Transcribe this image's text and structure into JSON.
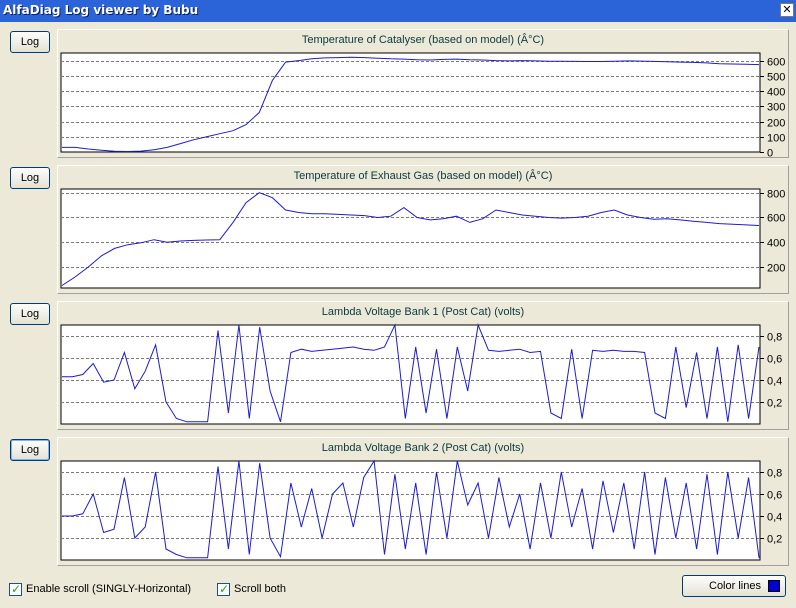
{
  "window": {
    "title": "AlfaDiag Log viewer by Bubu",
    "close_glyph": "✕"
  },
  "colors": {
    "line": "#1c1ccf",
    "title_bar": "#2a64d8",
    "swatch": "#0000d8"
  },
  "log_button_label": "Log",
  "charts": [
    {
      "title": "Temperature of Catalyser (based on model) (Â°C)",
      "y_ticks": [
        "600",
        "500",
        "400",
        "300",
        "200",
        "100",
        "0"
      ],
      "ylim": [
        0,
        650
      ]
    },
    {
      "title": "Temperature of Exhaust Gas (based on model) (Â°C)",
      "y_ticks": [
        "800",
        "600",
        "400",
        "200"
      ],
      "ylim": [
        30,
        830
      ]
    },
    {
      "title": "Lambda Voltage Bank 1 (Post Cat) (volts)",
      "y_ticks": [
        "0,8",
        "0,6",
        "0,4",
        "0,2"
      ],
      "ylim": [
        0,
        0.9
      ]
    },
    {
      "title": "Lambda Voltage Bank 2 (Post Cat) (volts)",
      "y_ticks": [
        "0,8",
        "0,6",
        "0,4",
        "0,2"
      ],
      "ylim": [
        0,
        0.9
      ]
    }
  ],
  "chart_data": [
    {
      "type": "line",
      "title": "Temperature of Catalyser (based on model) (Â°C)",
      "ylim": [
        0,
        650
      ],
      "grid": true,
      "series": [
        {
          "values": [
            30,
            30,
            20,
            12,
            5,
            3,
            6,
            15,
            30,
            55,
            80,
            100,
            120,
            140,
            180,
            260,
            470,
            590,
            600,
            612,
            618,
            620,
            622,
            620,
            616,
            612,
            610,
            606,
            604,
            608,
            610,
            606,
            604,
            600,
            598,
            600,
            598,
            596,
            596,
            595,
            594,
            594,
            596,
            598,
            597,
            595,
            592,
            590,
            588,
            585,
            580,
            578,
            576,
            574
          ]
        }
      ]
    },
    {
      "type": "line",
      "title": "Temperature of Exhaust Gas (based on model) (Â°C)",
      "ylim": [
        30,
        830
      ],
      "grid": true,
      "series": [
        {
          "values": [
            50,
            120,
            200,
            290,
            350,
            380,
            395,
            420,
            400,
            410,
            415,
            418,
            420,
            560,
            720,
            800,
            760,
            660,
            640,
            630,
            630,
            625,
            620,
            615,
            600,
            610,
            680,
            600,
            580,
            590,
            610,
            560,
            590,
            660,
            640,
            620,
            610,
            600,
            595,
            600,
            610,
            640,
            660,
            620,
            600,
            585,
            590,
            580,
            570,
            560,
            550,
            545,
            540,
            535
          ]
        }
      ]
    },
    {
      "type": "line",
      "title": "Lambda Voltage Bank 1 (Post Cat) (volts)",
      "ylim": [
        0,
        0.9
      ],
      "grid": true,
      "series": [
        {
          "values": [
            0.43,
            0.43,
            0.45,
            0.55,
            0.38,
            0.4,
            0.65,
            0.32,
            0.48,
            0.72,
            0.2,
            0.05,
            0.02,
            0.02,
            0.02,
            0.85,
            0.1,
            0.9,
            0.05,
            0.88,
            0.3,
            0.02,
            0.65,
            0.68,
            0.66,
            0.67,
            0.68,
            0.69,
            0.7,
            0.68,
            0.67,
            0.7,
            0.9,
            0.05,
            0.7,
            0.1,
            0.68,
            0.05,
            0.7,
            0.3,
            0.9,
            0.67,
            0.66,
            0.67,
            0.68,
            0.65,
            0.66,
            0.1,
            0.05,
            0.68,
            0.05,
            0.67,
            0.66,
            0.67,
            0.66,
            0.66,
            0.65,
            0.1,
            0.05,
            0.7,
            0.15,
            0.65,
            0.05,
            0.7,
            0.02,
            0.72,
            0.05,
            0.7
          ]
        }
      ]
    },
    {
      "type": "line",
      "title": "Lambda Voltage Bank 2 (Post Cat) (volts)",
      "ylim": [
        0,
        0.9
      ],
      "grid": true,
      "series": [
        {
          "values": [
            0.4,
            0.4,
            0.42,
            0.6,
            0.25,
            0.28,
            0.75,
            0.2,
            0.3,
            0.8,
            0.1,
            0.05,
            0.02,
            0.02,
            0.02,
            0.85,
            0.1,
            0.9,
            0.05,
            0.88,
            0.2,
            0.03,
            0.7,
            0.3,
            0.65,
            0.2,
            0.6,
            0.7,
            0.3,
            0.75,
            0.9,
            0.05,
            0.78,
            0.1,
            0.7,
            0.05,
            0.8,
            0.2,
            0.9,
            0.5,
            0.7,
            0.2,
            0.75,
            0.3,
            0.6,
            0.1,
            0.7,
            0.2,
            0.8,
            0.3,
            0.65,
            0.1,
            0.72,
            0.25,
            0.7,
            0.1,
            0.8,
            0.05,
            0.75,
            0.2,
            0.7,
            0.1,
            0.78,
            0.05,
            0.8,
            0.2,
            0.75,
            0.02
          ]
        }
      ]
    }
  ],
  "footer": {
    "enable_scroll_label": "Enable scroll (SINGLY-Horizontal)",
    "enable_scroll_checked": true,
    "scroll_both_label": "Scroll both",
    "scroll_both_checked": true,
    "color_lines_label": "Color lines",
    "check_glyph": "✓"
  }
}
